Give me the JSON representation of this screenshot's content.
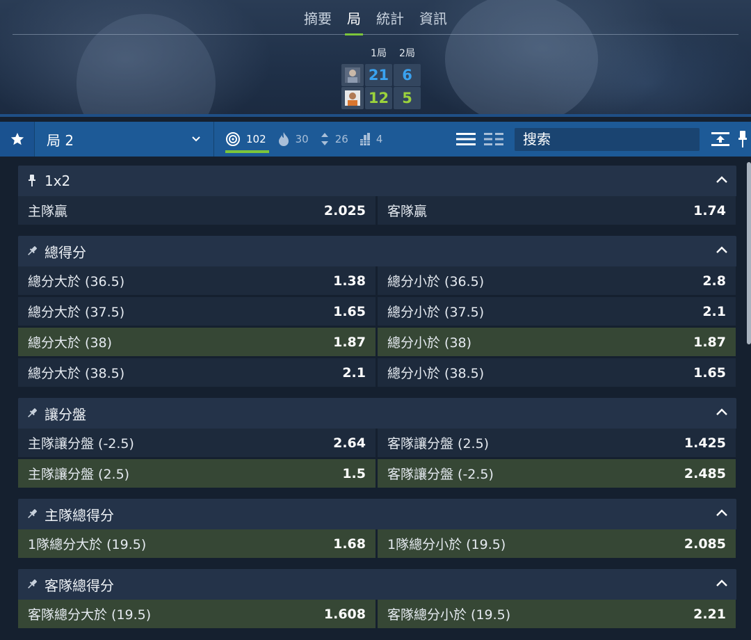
{
  "tabs": [
    {
      "label": "摘要"
    },
    {
      "label": "局"
    },
    {
      "label": "統計"
    },
    {
      "label": "資訊"
    }
  ],
  "scoreboard": {
    "periods": [
      "1局",
      "2局"
    ],
    "players": [
      {
        "scores": [
          "21",
          "6"
        ],
        "color": "#3aa2f0"
      },
      {
        "scores": [
          "12",
          "5"
        ],
        "color": "#9bd23c"
      }
    ]
  },
  "toolbar": {
    "period": "局 2",
    "counters": [
      {
        "icon": "target-icon",
        "value": "102"
      },
      {
        "icon": "flame-icon",
        "value": "30"
      },
      {
        "icon": "up-down-arrows-icon",
        "value": "26"
      },
      {
        "icon": "bar-stack-icon",
        "value": "4"
      }
    ],
    "search_placeholder": "搜索"
  },
  "markets": [
    {
      "title": "1x2",
      "rows": [
        [
          {
            "label": "主隊贏",
            "odd": "2.025"
          },
          {
            "label": "客隊贏",
            "odd": "1.74"
          }
        ]
      ]
    },
    {
      "title": "總得分",
      "rows": [
        [
          {
            "label": "總分大於 (36.5)",
            "odd": "1.38"
          },
          {
            "label": "總分小於 (36.5)",
            "odd": "2.8"
          }
        ],
        [
          {
            "label": "總分大於 (37.5)",
            "odd": "1.65"
          },
          {
            "label": "總分小於 (37.5)",
            "odd": "2.1"
          }
        ],
        [
          {
            "label": "總分大於 (38)",
            "odd": "1.87",
            "highlight": true
          },
          {
            "label": "總分小於 (38)",
            "odd": "1.87",
            "highlight": true
          }
        ],
        [
          {
            "label": "總分大於 (38.5)",
            "odd": "2.1"
          },
          {
            "label": "總分小於 (38.5)",
            "odd": "1.65"
          }
        ]
      ]
    },
    {
      "title": "讓分盤",
      "rows": [
        [
          {
            "label": "主隊讓分盤 (-2.5)",
            "odd": "2.64"
          },
          {
            "label": "客隊讓分盤 (2.5)",
            "odd": "1.425"
          }
        ],
        [
          {
            "label": "主隊讓分盤 (2.5)",
            "odd": "1.5",
            "highlight": true
          },
          {
            "label": "客隊讓分盤 (-2.5)",
            "odd": "2.485",
            "highlight": true
          }
        ]
      ]
    },
    {
      "title": "主隊總得分",
      "rows": [
        [
          {
            "label": "1隊總分大於 (19.5)",
            "odd": "1.68",
            "highlight": true
          },
          {
            "label": "1隊總分小於 (19.5)",
            "odd": "2.085",
            "highlight": true
          }
        ]
      ]
    },
    {
      "title": "客隊總得分",
      "rows": [
        [
          {
            "label": "客隊總分大於 (19.5)",
            "odd": "1.608",
            "highlight": true
          },
          {
            "label": "客隊總分小於 (19.5)",
            "odd": "2.21",
            "highlight": true
          }
        ]
      ]
    }
  ],
  "colors": {
    "accent_green": "#7cc63a",
    "toolbar_blue": "#1d5a97",
    "highlight_row": "#364735"
  }
}
